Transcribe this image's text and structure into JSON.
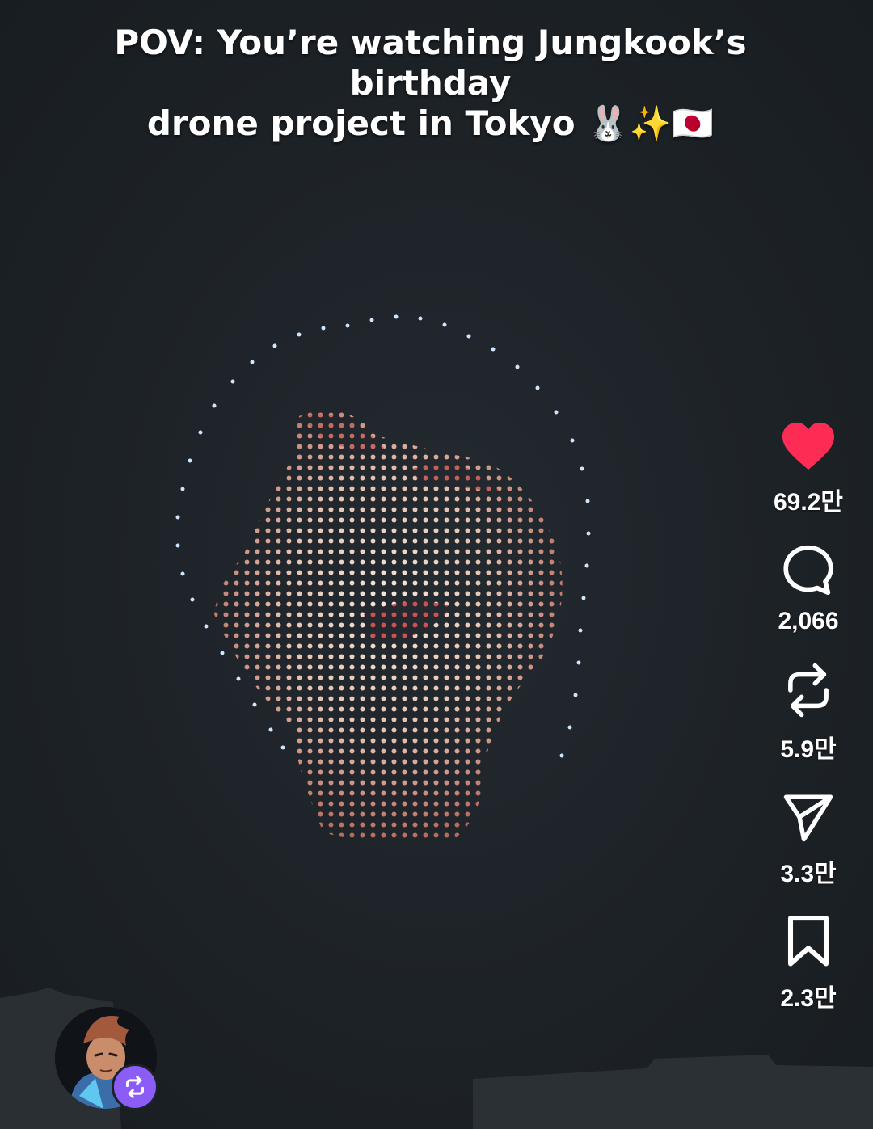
{
  "video": {
    "caption_line1": "POV: You’re watching Jungkook’s birthday",
    "caption_line2": "drone project in Tokyo 🐰✨🇯🇵"
  },
  "actions": {
    "like": {
      "icon": "heart-icon",
      "count": "69.2만",
      "color": "#fe2c55"
    },
    "comment": {
      "icon": "comment-bubble-icon",
      "count": "2,066"
    },
    "repost": {
      "icon": "repost-icon",
      "count": "5.9만"
    },
    "share": {
      "icon": "share-paper-plane-icon",
      "count": "3.3만"
    },
    "save": {
      "icon": "bookmark-icon",
      "count": "2.3만"
    }
  },
  "creator": {
    "avatar_icon": "anime-character-avatar",
    "badge_icon": "repost-badge-icon",
    "badge_color": "#8b5cf6"
  }
}
